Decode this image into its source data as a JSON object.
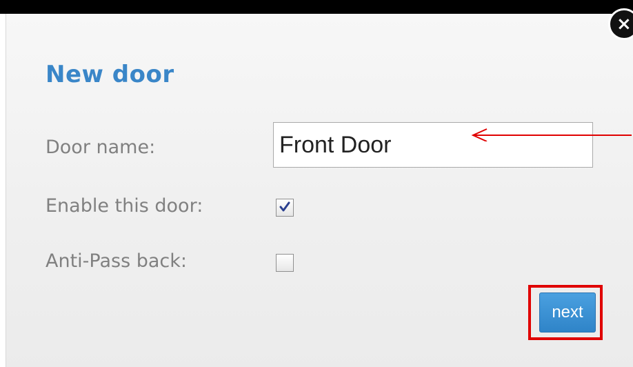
{
  "dialog": {
    "title": "New door",
    "close_label": "×",
    "fields": {
      "door_name": {
        "label": "Door name:",
        "value": "Front Door"
      },
      "enable": {
        "label": "Enable this door:",
        "checked": true
      },
      "anti_pass_back": {
        "label": "Anti-Pass back:",
        "checked": false
      }
    },
    "next_label": "next"
  },
  "annotations": {
    "highlight_color": "#e00000",
    "arrow_color": "#e00000"
  },
  "colors": {
    "title": "#3a86c8",
    "label": "#808080",
    "button": "#3a8fd0"
  }
}
